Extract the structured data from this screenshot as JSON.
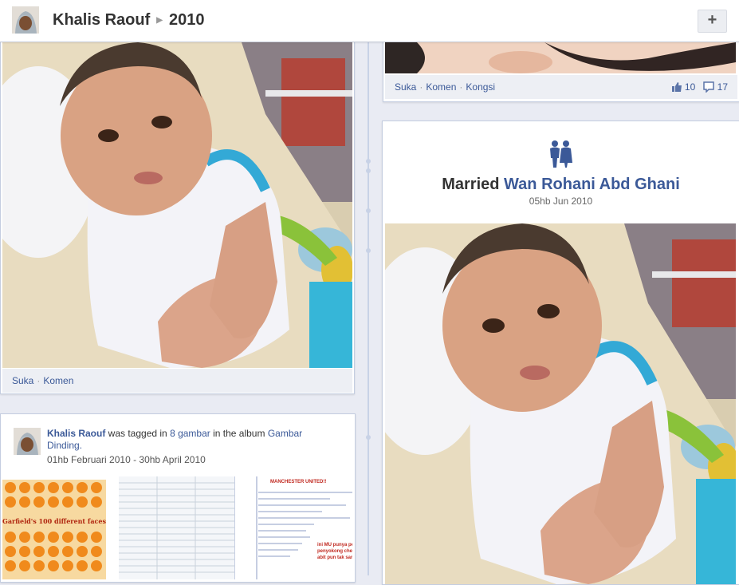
{
  "header": {
    "name": "Khalis Raouf",
    "year": "2010",
    "add_label": "+"
  },
  "left_photo_post": {
    "actions": [
      "Suka",
      "Komen"
    ]
  },
  "right_top_post": {
    "actions": [
      "Suka",
      "Komen",
      "Kongsi"
    ],
    "likes": "10",
    "comments": "17"
  },
  "life_event": {
    "icon": "couple-icon",
    "event": "Married",
    "partner": "Wan Rohani Abd Ghani",
    "date": "05hb Jun 2010"
  },
  "tag_post": {
    "user": "Khalis Raouf",
    "text_a": " was tagged in ",
    "count_link": "8 gambar",
    "text_b": " in the album ",
    "album": "Gambar Dinding.",
    "range": "01hb Februari 2010 - 30hb April 2010",
    "thumb_caption": "Garfield's 100 different faces",
    "thumb2_header": "MANCHESTER UNITED!!",
    "thumb2_note": "ini MU punya pe\npenyokong chelsi\nabit pun tak sam"
  },
  "colors": {
    "link": "#3b5998",
    "timeline_spine": "#c8d2e6",
    "action_bar": "#edeff4",
    "background": "#e9ebf3"
  }
}
